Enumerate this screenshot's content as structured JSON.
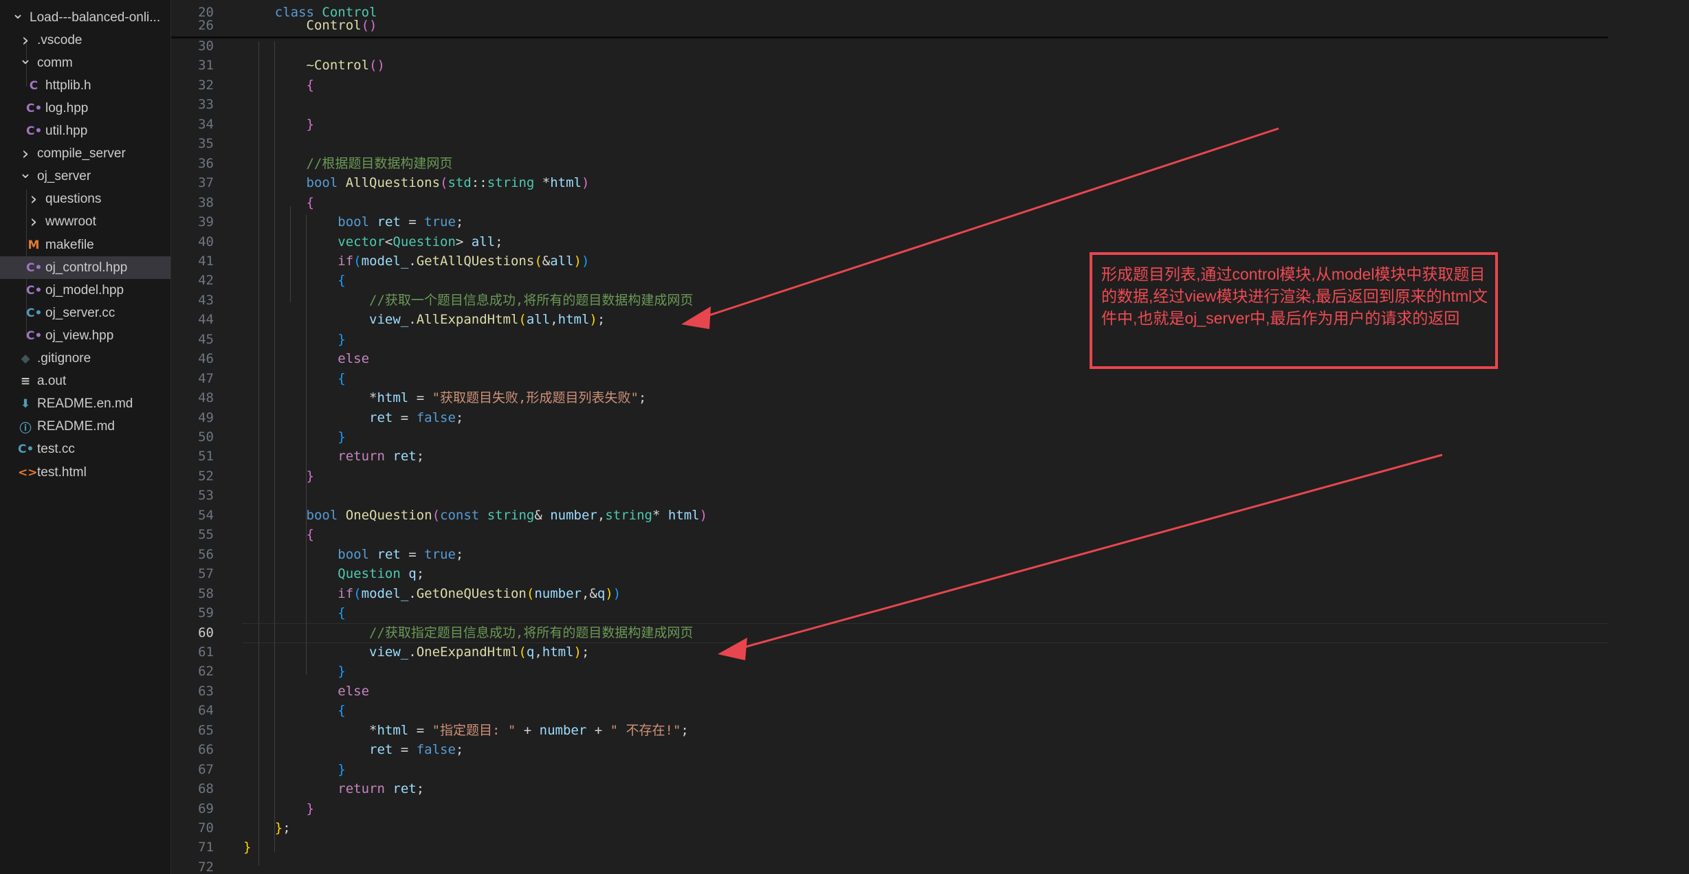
{
  "explorer": {
    "items": [
      {
        "name": "Load---balanced-onli...",
        "icon": "chevron-down",
        "color": "#cccccc",
        "depth": 0
      },
      {
        "name": ".vscode",
        "icon": "chevron-right",
        "color": "#cccccc",
        "depth": 1
      },
      {
        "name": "comm",
        "icon": "chevron-down",
        "color": "#cccccc",
        "depth": 1
      },
      {
        "name": "httplib.h",
        "icon": "C",
        "color": "#a074c4",
        "depth": 2
      },
      {
        "name": "log.hpp",
        "icon": "C+",
        "color": "#a074c4",
        "depth": 2
      },
      {
        "name": "util.hpp",
        "icon": "C+",
        "color": "#a074c4",
        "depth": 2
      },
      {
        "name": "compile_server",
        "icon": "chevron-right",
        "color": "#cccccc",
        "depth": 1
      },
      {
        "name": "oj_server",
        "icon": "chevron-down",
        "color": "#cccccc",
        "depth": 1
      },
      {
        "name": "questions",
        "icon": "chevron-right",
        "color": "#cccccc",
        "depth": 2
      },
      {
        "name": "wwwroot",
        "icon": "chevron-right",
        "color": "#cccccc",
        "depth": 2
      },
      {
        "name": "makefile",
        "icon": "M",
        "color": "#e37933",
        "depth": 2
      },
      {
        "name": "oj_control.hpp",
        "icon": "C+",
        "color": "#a074c4",
        "depth": 2,
        "selected": true
      },
      {
        "name": "oj_model.hpp",
        "icon": "C+",
        "color": "#a074c4",
        "depth": 2
      },
      {
        "name": "oj_server.cc",
        "icon": "C+",
        "color": "#519aba",
        "depth": 2
      },
      {
        "name": "oj_view.hpp",
        "icon": "C+",
        "color": "#a074c4",
        "depth": 2
      },
      {
        "name": ".gitignore",
        "icon": "git",
        "color": "#41535b",
        "depth": 1
      },
      {
        "name": "a.out",
        "icon": "lines",
        "color": "#cccccc",
        "depth": 1
      },
      {
        "name": "README.en.md",
        "icon": "down",
        "color": "#519aba",
        "depth": 1
      },
      {
        "name": "README.md",
        "icon": "info",
        "color": "#519aba",
        "depth": 1
      },
      {
        "name": "test.cc",
        "icon": "C+",
        "color": "#519aba",
        "depth": 1
      },
      {
        "name": "test.html",
        "icon": "tag",
        "color": "#e37933",
        "depth": 1
      }
    ]
  },
  "editor": {
    "active_line": "60",
    "sticky": [
      {
        "n": "20",
        "t": [
          [
            "    ",
            "pn"
          ],
          [
            "class",
            "kw"
          ],
          [
            " ",
            "pn"
          ],
          [
            "Control",
            "ty"
          ]
        ]
      },
      {
        "n": "26",
        "t": [
          [
            "        ",
            "pn"
          ],
          [
            "Control",
            "fn"
          ],
          [
            "()",
            "b2"
          ]
        ]
      }
    ],
    "lines": [
      {
        "n": "30",
        "t": []
      },
      {
        "n": "31",
        "t": [
          [
            "        ",
            "pn"
          ],
          [
            "~Control",
            "fn"
          ],
          [
            "()",
            "b2"
          ]
        ]
      },
      {
        "n": "32",
        "t": [
          [
            "        ",
            "pn"
          ],
          [
            "{",
            "b2"
          ]
        ]
      },
      {
        "n": "33",
        "t": []
      },
      {
        "n": "34",
        "t": [
          [
            "        ",
            "pn"
          ],
          [
            "}",
            "b2"
          ]
        ]
      },
      {
        "n": "35",
        "t": []
      },
      {
        "n": "36",
        "t": [
          [
            "        ",
            "pn"
          ],
          [
            "//根据题目数据构建网页",
            "cmt"
          ]
        ]
      },
      {
        "n": "37",
        "t": [
          [
            "        ",
            "pn"
          ],
          [
            "bool",
            "kw"
          ],
          [
            " ",
            "pn"
          ],
          [
            "AllQuestions",
            "fn"
          ],
          [
            "(",
            "b2"
          ],
          [
            "std",
            "ns"
          ],
          [
            "::",
            "pn"
          ],
          [
            "string",
            "ty"
          ],
          [
            " *",
            "op"
          ],
          [
            "html",
            "var"
          ],
          [
            ")",
            "b2"
          ]
        ]
      },
      {
        "n": "38",
        "t": [
          [
            "        ",
            "pn"
          ],
          [
            "{",
            "b2"
          ]
        ]
      },
      {
        "n": "39",
        "t": [
          [
            "            ",
            "pn"
          ],
          [
            "bool",
            "kw"
          ],
          [
            " ",
            "pn"
          ],
          [
            "ret",
            "var"
          ],
          [
            " = ",
            "op"
          ],
          [
            "true",
            "kw"
          ],
          [
            ";",
            "pn"
          ]
        ]
      },
      {
        "n": "40",
        "t": [
          [
            "            ",
            "pn"
          ],
          [
            "vector",
            "ty"
          ],
          [
            "<",
            "pn"
          ],
          [
            "Question",
            "ty"
          ],
          [
            "> ",
            "pn"
          ],
          [
            "all",
            "var"
          ],
          [
            ";",
            "pn"
          ]
        ]
      },
      {
        "n": "41",
        "t": [
          [
            "            ",
            "pn"
          ],
          [
            "if",
            "ctl"
          ],
          [
            "(",
            "b3"
          ],
          [
            "model_",
            "var"
          ],
          [
            ".",
            "pn"
          ],
          [
            "GetAllQUestions",
            "fn"
          ],
          [
            "(",
            "b1"
          ],
          [
            "&",
            "op"
          ],
          [
            "all",
            "var"
          ],
          [
            ")",
            "b1"
          ],
          [
            ")",
            "b3"
          ]
        ]
      },
      {
        "n": "42",
        "t": [
          [
            "            ",
            "pn"
          ],
          [
            "{",
            "b3"
          ]
        ]
      },
      {
        "n": "43",
        "t": [
          [
            "                ",
            "pn"
          ],
          [
            "//获取一个题目信息成功,将所有的题目数据构建成网页",
            "cmt"
          ]
        ]
      },
      {
        "n": "44",
        "t": [
          [
            "                ",
            "pn"
          ],
          [
            "view_",
            "var"
          ],
          [
            ".",
            "pn"
          ],
          [
            "AllExpandHtml",
            "fn"
          ],
          [
            "(",
            "b1"
          ],
          [
            "all",
            "var"
          ],
          [
            ",",
            "pn"
          ],
          [
            "html",
            "var"
          ],
          [
            ")",
            "b1"
          ],
          [
            ";",
            "pn"
          ]
        ]
      },
      {
        "n": "45",
        "t": [
          [
            "            ",
            "pn"
          ],
          [
            "}",
            "b3"
          ]
        ]
      },
      {
        "n": "46",
        "t": [
          [
            "            ",
            "pn"
          ],
          [
            "else",
            "ctl"
          ]
        ]
      },
      {
        "n": "47",
        "t": [
          [
            "            ",
            "pn"
          ],
          [
            "{",
            "b3"
          ]
        ]
      },
      {
        "n": "48",
        "t": [
          [
            "                ",
            "pn"
          ],
          [
            "*",
            "op"
          ],
          [
            "html",
            "var"
          ],
          [
            " = ",
            "op"
          ],
          [
            "\"获取题目失败,形成题目列表失败\"",
            "str"
          ],
          [
            ";",
            "pn"
          ]
        ]
      },
      {
        "n": "49",
        "t": [
          [
            "                ",
            "pn"
          ],
          [
            "ret",
            "var"
          ],
          [
            " = ",
            "op"
          ],
          [
            "false",
            "kw"
          ],
          [
            ";",
            "pn"
          ]
        ]
      },
      {
        "n": "50",
        "t": [
          [
            "            ",
            "pn"
          ],
          [
            "}",
            "b3"
          ]
        ]
      },
      {
        "n": "51",
        "t": [
          [
            "            ",
            "pn"
          ],
          [
            "return",
            "ctl"
          ],
          [
            " ",
            "pn"
          ],
          [
            "ret",
            "var"
          ],
          [
            ";",
            "pn"
          ]
        ]
      },
      {
        "n": "52",
        "t": [
          [
            "        ",
            "pn"
          ],
          [
            "}",
            "b2"
          ]
        ]
      },
      {
        "n": "53",
        "t": []
      },
      {
        "n": "54",
        "t": [
          [
            "        ",
            "pn"
          ],
          [
            "bool",
            "kw"
          ],
          [
            " ",
            "pn"
          ],
          [
            "OneQuestion",
            "fn"
          ],
          [
            "(",
            "b2"
          ],
          [
            "const",
            "kw"
          ],
          [
            " ",
            "pn"
          ],
          [
            "string",
            "ty"
          ],
          [
            "& ",
            "op"
          ],
          [
            "number",
            "var"
          ],
          [
            ",",
            "pn"
          ],
          [
            "string",
            "ty"
          ],
          [
            "* ",
            "op"
          ],
          [
            "html",
            "var"
          ],
          [
            ")",
            "b2"
          ]
        ]
      },
      {
        "n": "55",
        "t": [
          [
            "        ",
            "pn"
          ],
          [
            "{",
            "b2"
          ]
        ]
      },
      {
        "n": "56",
        "t": [
          [
            "            ",
            "pn"
          ],
          [
            "bool",
            "kw"
          ],
          [
            " ",
            "pn"
          ],
          [
            "ret",
            "var"
          ],
          [
            " = ",
            "op"
          ],
          [
            "true",
            "kw"
          ],
          [
            ";",
            "pn"
          ]
        ]
      },
      {
        "n": "57",
        "t": [
          [
            "            ",
            "pn"
          ],
          [
            "Question",
            "ty"
          ],
          [
            " ",
            "pn"
          ],
          [
            "q",
            "var"
          ],
          [
            ";",
            "pn"
          ]
        ]
      },
      {
        "n": "58",
        "t": [
          [
            "            ",
            "pn"
          ],
          [
            "if",
            "ctl"
          ],
          [
            "(",
            "b3"
          ],
          [
            "model_",
            "var"
          ],
          [
            ".",
            "pn"
          ],
          [
            "GetOneQUestion",
            "fn"
          ],
          [
            "(",
            "b1"
          ],
          [
            "number",
            "var"
          ],
          [
            ",&",
            "pn"
          ],
          [
            "q",
            "var"
          ],
          [
            ")",
            "b1"
          ],
          [
            ")",
            "b3"
          ]
        ]
      },
      {
        "n": "59",
        "t": [
          [
            "            ",
            "pn"
          ],
          [
            "{",
            "b3"
          ]
        ]
      },
      {
        "n": "60",
        "t": [
          [
            "                ",
            "pn"
          ],
          [
            "//获取指定题目信息成功,将所有的题目数据构建成网页",
            "cmt"
          ]
        ]
      },
      {
        "n": "61",
        "t": [
          [
            "                ",
            "pn"
          ],
          [
            "view_",
            "var"
          ],
          [
            ".",
            "pn"
          ],
          [
            "OneExpandHtml",
            "fn"
          ],
          [
            "(",
            "b1"
          ],
          [
            "q",
            "var"
          ],
          [
            ",",
            "pn"
          ],
          [
            "html",
            "var"
          ],
          [
            ")",
            "b1"
          ],
          [
            ";",
            "pn"
          ]
        ]
      },
      {
        "n": "62",
        "t": [
          [
            "            ",
            "pn"
          ],
          [
            "}",
            "b3"
          ]
        ]
      },
      {
        "n": "63",
        "t": [
          [
            "            ",
            "pn"
          ],
          [
            "else",
            "ctl"
          ]
        ]
      },
      {
        "n": "64",
        "t": [
          [
            "            ",
            "pn"
          ],
          [
            "{",
            "b3"
          ]
        ]
      },
      {
        "n": "65",
        "t": [
          [
            "                ",
            "pn"
          ],
          [
            "*",
            "op"
          ],
          [
            "html",
            "var"
          ],
          [
            " = ",
            "op"
          ],
          [
            "\"指定题目: \"",
            "str"
          ],
          [
            " + ",
            "op"
          ],
          [
            "number",
            "var"
          ],
          [
            " + ",
            "op"
          ],
          [
            "\" 不存在!\"",
            "str"
          ],
          [
            ";",
            "pn"
          ]
        ]
      },
      {
        "n": "66",
        "t": [
          [
            "                ",
            "pn"
          ],
          [
            "ret",
            "var"
          ],
          [
            " = ",
            "op"
          ],
          [
            "false",
            "kw"
          ],
          [
            ";",
            "pn"
          ]
        ]
      },
      {
        "n": "67",
        "t": [
          [
            "            ",
            "pn"
          ],
          [
            "}",
            "b3"
          ]
        ]
      },
      {
        "n": "68",
        "t": [
          [
            "            ",
            "pn"
          ],
          [
            "return",
            "ctl"
          ],
          [
            " ",
            "pn"
          ],
          [
            "ret",
            "var"
          ],
          [
            ";",
            "pn"
          ]
        ]
      },
      {
        "n": "69",
        "t": [
          [
            "        ",
            "pn"
          ],
          [
            "}",
            "b2"
          ]
        ]
      },
      {
        "n": "70",
        "t": [
          [
            "    ",
            "pn"
          ],
          [
            "}",
            "b1"
          ],
          [
            ";",
            "pn"
          ]
        ]
      },
      {
        "n": "71",
        "t": [
          [
            "}",
            "b1"
          ]
        ]
      },
      {
        "n": "72",
        "t": []
      }
    ]
  },
  "annotation": {
    "text": "形成题目列表,通过control模块,从model模块中获取题目的数据,经过view模块进行渲染,最后返回到原来的html文件中,也就是oj_server中,最后作为用户的请求的返回",
    "color": "#e8464e"
  },
  "colors": {
    "background": "#1f1f1f",
    "sidebar": "#181818",
    "selected_row": "#37373d",
    "annotation_red": "#e8464e"
  }
}
